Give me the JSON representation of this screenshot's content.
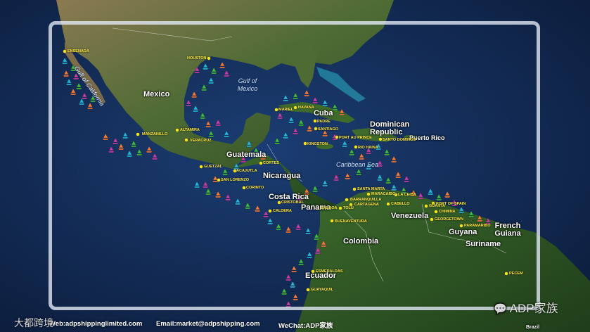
{
  "map": {
    "countries": [
      {
        "name": "Mexico"
      },
      {
        "name": "Cuba"
      },
      {
        "name": "Dominican Republic"
      },
      {
        "name": "Puerto Rico"
      },
      {
        "name": "Guatemala"
      },
      {
        "name": "Nicaragua"
      },
      {
        "name": "Costa Rica"
      },
      {
        "name": "Panama"
      },
      {
        "name": "Venezuela"
      },
      {
        "name": "Colombia"
      },
      {
        "name": "Guyana"
      },
      {
        "name": "French Guiana"
      },
      {
        "name": "Suriname"
      },
      {
        "name": "Ecuador"
      },
      {
        "name": "Brazil"
      }
    ],
    "waters": [
      {
        "name": "Gulf of California"
      },
      {
        "name": "Gulf of Mexico"
      },
      {
        "name": "Caribbean Sea"
      }
    ],
    "ports": [
      "ENSENADA",
      "HOUSTON",
      "MANZANILLO",
      "ALTAMIRA",
      "VERACRUZ",
      "MARIEL",
      "HAVANA",
      "PADRE",
      "SANTIAGO",
      "PORT AU PRINCE",
      "SANTO DOMINGO",
      "KINGSTON",
      "RIO HAINA",
      "GUETZAL",
      "CORTES",
      "ACAJUTLA",
      "SAN LORENZO",
      "CORINTO",
      "SANTA MARTA",
      "MARACAIBO",
      "LA CEIBA",
      "BARRANQUILLA",
      "CARTAGENA",
      "CABELLO",
      "GUANTA",
      "PORT OF SPAIN",
      "CRISTOBAL",
      "BALBOA",
      "CALDERA",
      "TOLU",
      "CHIMINA",
      "GEORGETOWN",
      "PARAMARIBO",
      "BUENAVENTURA",
      "ESMERALDAS",
      "GUAYAQUIL",
      "PECEM"
    ],
    "colors": {
      "ocean": "#122c5a",
      "land": "#4d6a3a",
      "sail_cyan": "#27b5d9",
      "sail_green": "#3dbb3d",
      "sail_orange": "#f07a3a",
      "sail_magenta": "#c43fa6",
      "port_dot": "#f4e516"
    }
  },
  "footer": {
    "website": "Web:adpshippinglimited.com",
    "email": "Email:market@adpshipping.com",
    "wechat": "WeChat:ADP家族"
  },
  "watermarks": {
    "brand": "ADP家族",
    "left": "大都跨境"
  }
}
